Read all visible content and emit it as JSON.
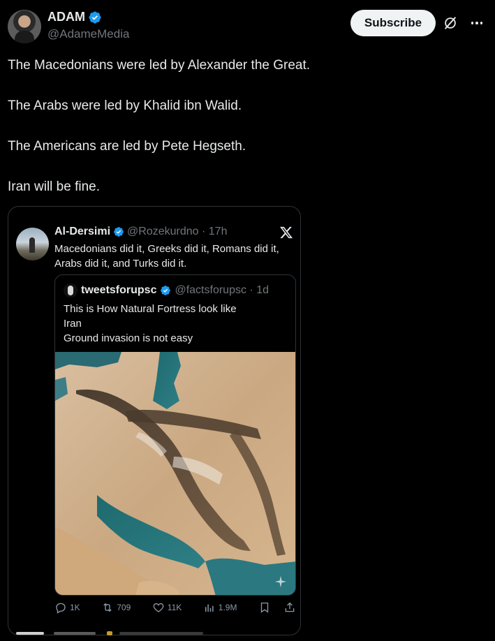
{
  "post": {
    "author_name": "ADAM",
    "author_handle": "@AdameMedia",
    "subscribe_label": "Subscribe",
    "lines": [
      "The Macedonians were led by Alexander the Great.",
      "The Arabs were led by Khalid ibn Walid.",
      "The Americans are led by Pete Hegseth.",
      "Iran will be fine."
    ]
  },
  "quoted": {
    "name": "Al-Dersimi",
    "handle_time": "@Rozekurdno · 17h",
    "text": "Macedonians did it, Greeks did it, Romans  did it, Arabs did it, and Turks did it.",
    "inner": {
      "name": "tweetsforupsc",
      "handle_time": "@factsforupsc · 1d",
      "lines": [
        "This is How Natural Fortress look like",
        "Iran",
        "Ground invasion is not easy"
      ]
    },
    "stats": {
      "replies": "1K",
      "reposts": "709",
      "likes": "11K",
      "views": "1.9M"
    }
  },
  "colors": {
    "background": "#000000",
    "verified_blue": "#1d9bf0",
    "muted_text": "#71767b"
  },
  "icons": [
    "verified-badge-icon",
    "grok-icon",
    "more-icon",
    "x-logo-icon",
    "reply-icon",
    "repost-icon",
    "like-icon",
    "views-icon",
    "bookmark-icon",
    "share-icon",
    "sparkle-icon"
  ]
}
